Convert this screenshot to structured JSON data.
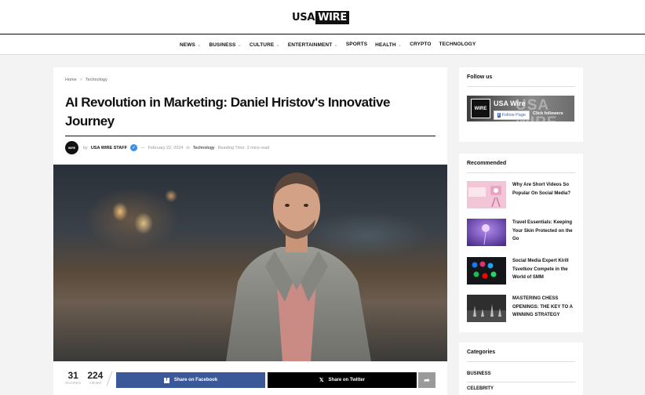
{
  "site": {
    "logo_left": "USA",
    "logo_right": "WIRE"
  },
  "nav": {
    "items": [
      {
        "label": "NEWS",
        "caret": true
      },
      {
        "label": "BUSINESS",
        "caret": true
      },
      {
        "label": "CULTURE",
        "caret": true
      },
      {
        "label": "ENTERTAINMENT",
        "caret": true
      },
      {
        "label": "SPORTS",
        "caret": false
      },
      {
        "label": "HEALTH",
        "caret": true
      },
      {
        "label": "CRYPTO",
        "caret": false
      },
      {
        "label": "TECHNOLOGY",
        "caret": false
      }
    ]
  },
  "breadcrumb": {
    "home": "Home",
    "separator": ">",
    "current": "Technology"
  },
  "article": {
    "title": "AI Revolution in Marketing: Daniel Hristov's Innovative Journey",
    "avatar_text": "WIRE",
    "by": "by",
    "author": "USA WIRE STAFF",
    "dash": "—",
    "date": "February 22, 2024",
    "in": "in",
    "category": "Technology",
    "reading_time": "Reading Time: 3 mins read"
  },
  "share": {
    "shares_count": "31",
    "shares_label": "SHARES",
    "views_count": "224",
    "views_label": "VIEWS",
    "facebook_label": "Share on Facebook",
    "twitter_label": "Share on Twitter"
  },
  "follow": {
    "title": "Follow us",
    "page_logo": "WIRE",
    "page_name": "USA Wire",
    "ghost_text": "USA WIRE",
    "follow_btn": "Follow Page",
    "followers": "Click followers"
  },
  "recommended": {
    "title": "Recommended",
    "items": [
      {
        "title": "Why Are Short Videos So Popular On Social Media?"
      },
      {
        "title": "Travel Essentials: Keeping Your Skin Protected on the Go"
      },
      {
        "title": "Social Media Expert Kirill Tsvetkov Compete in the World of SMM"
      },
      {
        "title": "MASTERING CHESS OPENINGS: THE KEY TO A WINNING STRATEGY"
      }
    ]
  },
  "categories": {
    "title": "Categories",
    "items": [
      "BUSINESS",
      "CELEBRITY"
    ]
  },
  "colors": {
    "facebook": "#3b5998",
    "twitter": "#000000",
    "accent": "#111111",
    "verified": "#3a8ee6"
  }
}
